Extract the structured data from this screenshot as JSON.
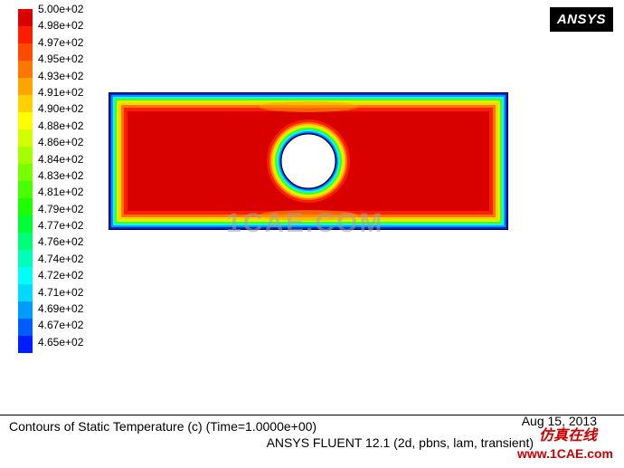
{
  "brand_logo": "ANSYS",
  "legend_ticks": [
    "5.00e+02",
    "4.98e+02",
    "4.97e+02",
    "4.95e+02",
    "4.93e+02",
    "4.91e+02",
    "4.90e+02",
    "4.88e+02",
    "4.86e+02",
    "4.84e+02",
    "4.83e+02",
    "4.81e+02",
    "4.79e+02",
    "4.77e+02",
    "4.76e+02",
    "4.74e+02",
    "4.72e+02",
    "4.71e+02",
    "4.69e+02",
    "4.67e+02",
    "4.65e+02"
  ],
  "legend_colors": [
    "#d90000",
    "#ff1d00",
    "#ff4a00",
    "#ff7700",
    "#ffa400",
    "#ffd100",
    "#fffe00",
    "#d1ff00",
    "#a4ff00",
    "#77ff00",
    "#4aff00",
    "#1dff00",
    "#00ff38",
    "#00ff77",
    "#00ffb6",
    "#00fff5",
    "#00daff",
    "#009bff",
    "#005cff",
    "#001dff"
  ],
  "plot_title_line1": "Contours of Static Temperature (c)  (Time=1.0000e+00)",
  "plot_title_line2": "ANSYS FLUENT 12.1 (2d, pbns, lam, transient)",
  "date_text": "Aug 15, 2013",
  "watermark_center": "1CAE.COM",
  "watermark_right": "仿真在线",
  "url_watermark": "www.1CAE.com",
  "chart_data": {
    "type": "heatmap",
    "title": "Contours of Static Temperature (c)",
    "time": 1.0,
    "software": "ANSYS FLUENT 12.1",
    "solver": "2d, pbns, lam, transient",
    "variable": "Static Temperature",
    "units": "c",
    "value_range": [
      465,
      500
    ],
    "colormap_stops": [
      {
        "value": 500,
        "color": "#d90000"
      },
      {
        "value": 498,
        "color": "#ff1d00"
      },
      {
        "value": 497,
        "color": "#ff4a00"
      },
      {
        "value": 495,
        "color": "#ff7700"
      },
      {
        "value": 493,
        "color": "#ffa400"
      },
      {
        "value": 491,
        "color": "#ffd100"
      },
      {
        "value": 490,
        "color": "#fffe00"
      },
      {
        "value": 488,
        "color": "#d1ff00"
      },
      {
        "value": 486,
        "color": "#a4ff00"
      },
      {
        "value": 484,
        "color": "#77ff00"
      },
      {
        "value": 483,
        "color": "#4aff00"
      },
      {
        "value": 481,
        "color": "#1dff00"
      },
      {
        "value": 479,
        "color": "#00ff38"
      },
      {
        "value": 477,
        "color": "#00ff77"
      },
      {
        "value": 476,
        "color": "#00ffb6"
      },
      {
        "value": 474,
        "color": "#00fff5"
      },
      {
        "value": 472,
        "color": "#00daff"
      },
      {
        "value": 471,
        "color": "#009bff"
      },
      {
        "value": 469,
        "color": "#005cff"
      },
      {
        "value": 467,
        "color": "#001dff"
      },
      {
        "value": 465,
        "color": "#0000ff"
      }
    ],
    "domain_description": "Rectangular 2-D slab with circular void near center; boundaries near minimum temperature, interior near maximum, thin thermal boundary layer at walls and around circle."
  }
}
